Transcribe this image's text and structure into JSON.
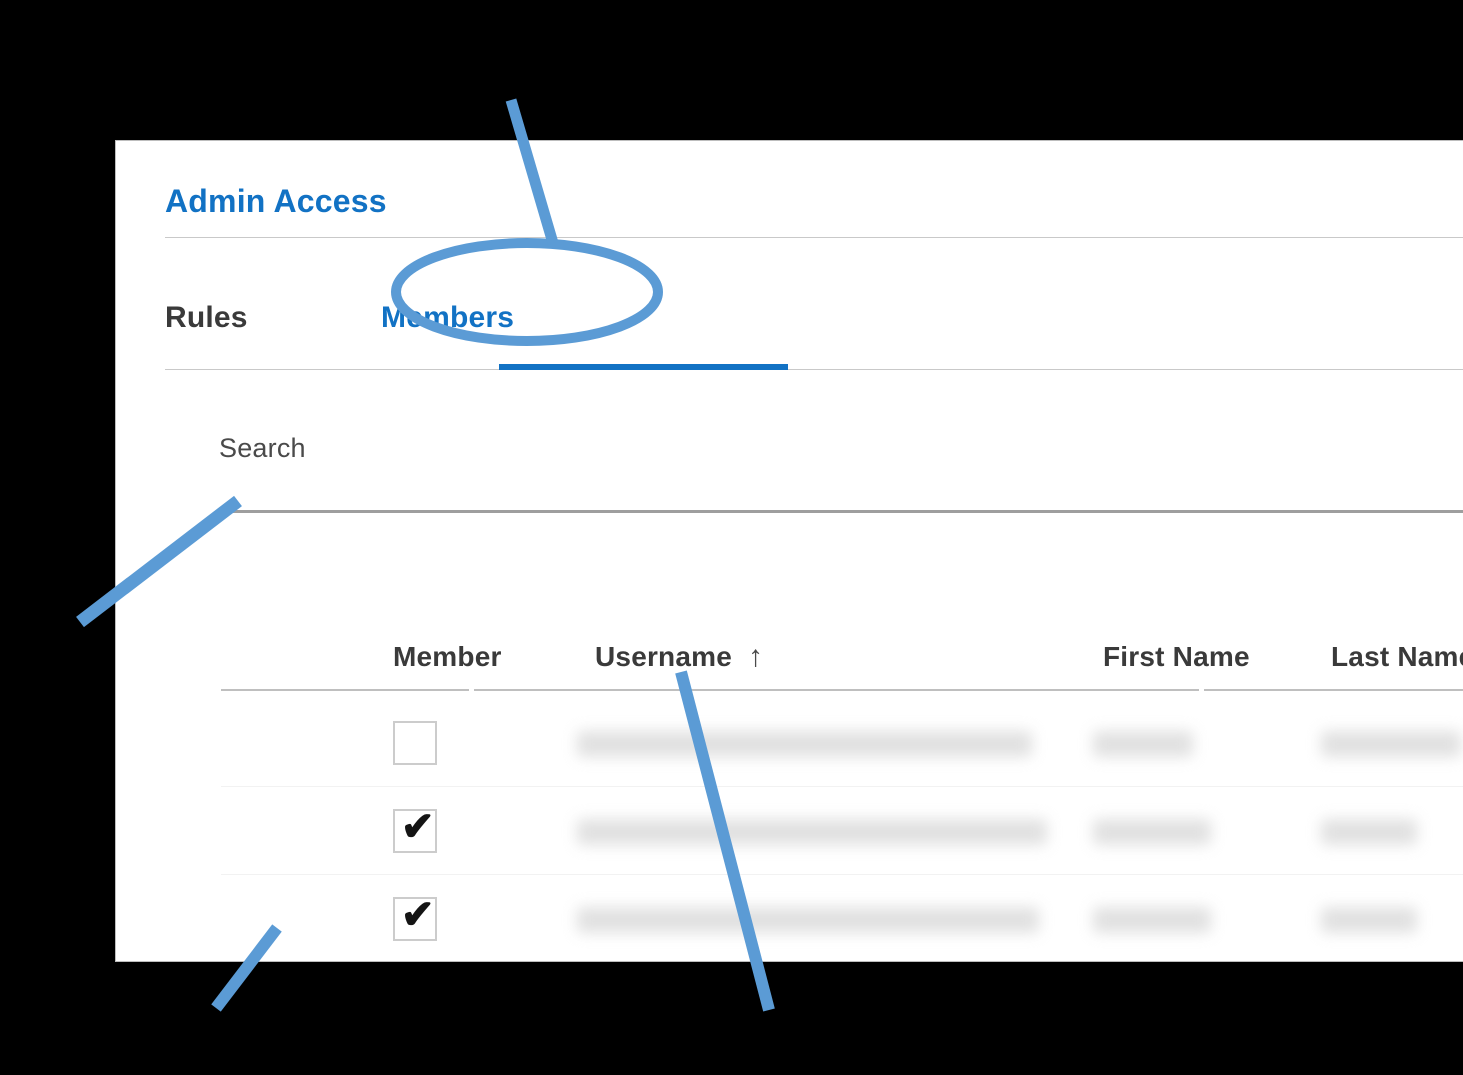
{
  "panel": {
    "title": "Admin Access"
  },
  "tabs": [
    {
      "label": "Rules",
      "active": false
    },
    {
      "label": "Members",
      "active": true
    }
  ],
  "search": {
    "label": "Search",
    "value": "",
    "placeholder": ""
  },
  "table": {
    "columns": [
      {
        "label": "Member",
        "sorted": false
      },
      {
        "label": "Username",
        "sorted": true,
        "sort_direction": "ascending",
        "sort_icon": "arrow-up-icon"
      },
      {
        "label": "First Name",
        "sorted": false
      },
      {
        "label": "Last Name",
        "sorted": false
      }
    ],
    "rows": [
      {
        "checked": false,
        "username": "",
        "first_name": "",
        "last_name": "",
        "redacted": true
      },
      {
        "checked": true,
        "username": "",
        "first_name": "",
        "last_name": "",
        "redacted": true
      },
      {
        "checked": true,
        "username": "",
        "first_name": "",
        "last_name": "",
        "redacted": true
      }
    ]
  },
  "annotations": {
    "color": "#5b9bd5",
    "shapes": [
      {
        "type": "ellipse",
        "target": "tab-members"
      },
      {
        "type": "line",
        "target": "tab-members"
      },
      {
        "type": "line",
        "target": "search-field"
      },
      {
        "type": "line",
        "target": "username-sort-arrow"
      },
      {
        "type": "line",
        "target": "member-checkbox"
      }
    ]
  },
  "colors": {
    "accent_blue": "#1272c4",
    "annotation_blue": "#5b9bd5",
    "heading_gray": "#3a3a3a",
    "divider_gray": "#c9c9c9",
    "card_background": "#ffffff",
    "page_background": "#000000"
  }
}
